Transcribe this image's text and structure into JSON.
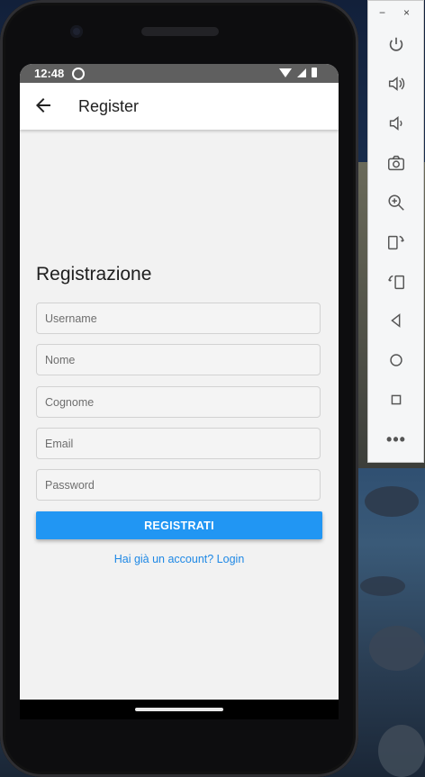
{
  "status_bar": {
    "time": "12:48"
  },
  "app_bar": {
    "title": "Register"
  },
  "form": {
    "heading": "Registrazione",
    "fields": [
      {
        "placeholder": "Username"
      },
      {
        "placeholder": "Nome"
      },
      {
        "placeholder": "Cognome"
      },
      {
        "placeholder": "Email"
      },
      {
        "placeholder": "Password"
      }
    ],
    "submit_label": "REGISTRATI",
    "login_link": "Hai già un account? Login"
  },
  "emulator_toolbar": {
    "minimize": "−",
    "close": "×",
    "more": "•••",
    "buttons": [
      "power-icon",
      "volume-up-icon",
      "volume-down-icon",
      "camera-icon",
      "zoom-icon",
      "rotate-left-icon",
      "rotate-right-icon",
      "back-nav-icon",
      "home-nav-icon",
      "overview-nav-icon",
      "more-icon"
    ]
  },
  "colors": {
    "accent": "#2196f3",
    "link": "#1e88e5",
    "status_bar": "#5f5f5f"
  }
}
